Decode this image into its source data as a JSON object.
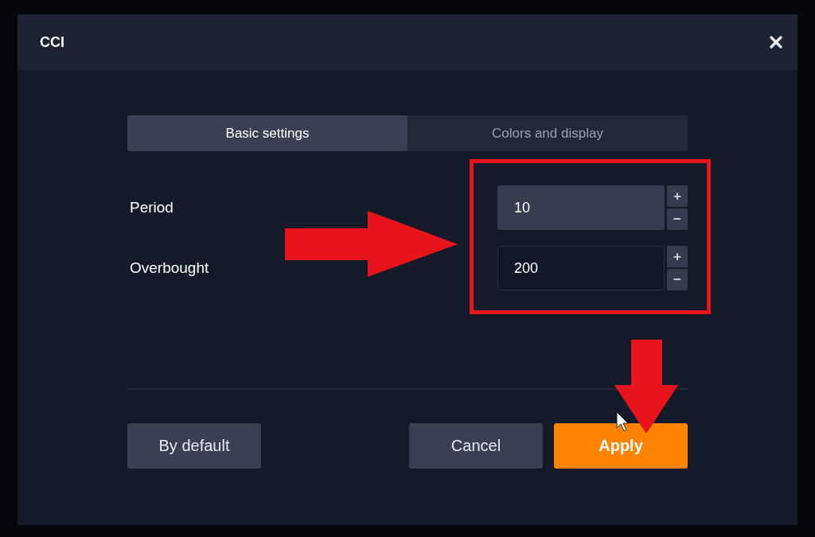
{
  "dialog": {
    "title": "CCI"
  },
  "tabs": [
    {
      "label": "Basic settings",
      "selected": true
    },
    {
      "label": "Colors and display",
      "selected": false
    }
  ],
  "fields": [
    {
      "label": "Period",
      "value": "10",
      "focused": false,
      "increment": "+",
      "decrement": "−"
    },
    {
      "label": "Overbought",
      "value": "200",
      "focused": true,
      "increment": "+",
      "decrement": "−"
    }
  ],
  "buttons": [
    {
      "label": "By default",
      "kind": "secondary"
    },
    {
      "label": "Cancel",
      "kind": "secondary"
    },
    {
      "label": "Apply",
      "kind": "primary"
    }
  ]
}
